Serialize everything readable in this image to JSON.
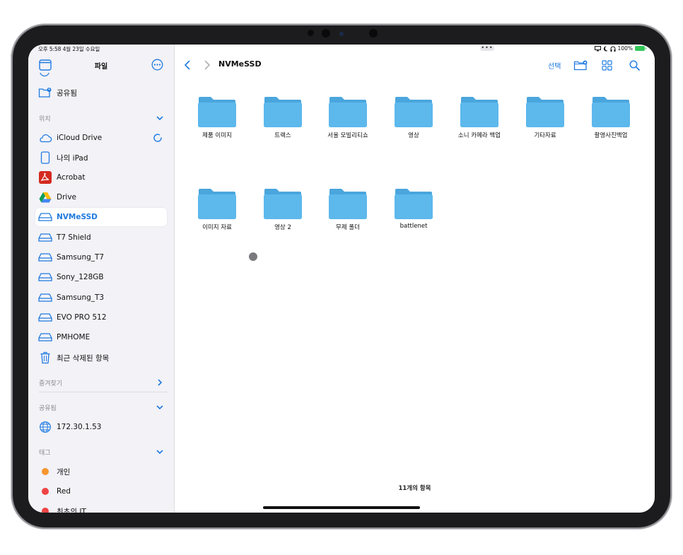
{
  "status": {
    "time_date": "오후 5:58  4월 23일 수요일",
    "battery": "100%"
  },
  "sidebar": {
    "title": "파일",
    "shared_top": "공유됨",
    "sections": {
      "locations": "위치",
      "favorites": "즐겨찾기",
      "shared": "공유됨",
      "tags": "태그"
    },
    "locations": [
      {
        "label": "iCloud Drive",
        "icon": "icloud-icon"
      },
      {
        "label": "나의 iPad",
        "icon": "ipad-icon"
      },
      {
        "label": "Acrobat",
        "icon": "acrobat-icon"
      },
      {
        "label": "Drive",
        "icon": "google-drive-icon"
      },
      {
        "label": "NVMeSSD",
        "icon": "drive-icon",
        "selected": true
      },
      {
        "label": "T7 Shield",
        "icon": "drive-icon"
      },
      {
        "label": "Samsung_T7",
        "icon": "drive-icon"
      },
      {
        "label": "Sony_128GB",
        "icon": "drive-icon"
      },
      {
        "label": "Samsung_T3",
        "icon": "drive-icon"
      },
      {
        "label": "EVO PRO 512",
        "icon": "drive-icon"
      },
      {
        "label": "PMHOME",
        "icon": "drive-icon"
      },
      {
        "label": "최근 삭제된 항목",
        "icon": "trash-icon"
      }
    ],
    "shared": [
      {
        "label": "172.30.1.53",
        "icon": "globe-icon"
      }
    ],
    "tags": [
      {
        "label": "개인",
        "color": "#f7962e"
      },
      {
        "label": "Red",
        "color": "#ee4444"
      },
      {
        "label": "최초의 IT",
        "color": "#ee4444"
      }
    ]
  },
  "toolbar": {
    "title": "NVMeSSD",
    "select_label": "선택"
  },
  "folders": [
    "제품 이미지",
    "트랙스",
    "서울 모빌리티쇼",
    "영상",
    "소니 카메라 백업",
    "기타자료",
    "촬영사진백업",
    "이미지 자료",
    "영상 2",
    "무제 폴더",
    "battlenet"
  ],
  "footer": {
    "count": "11개의 항목"
  },
  "colors": {
    "accent": "#1f7ae0",
    "folder": "#5db8ec",
    "folder_tab": "#4aa6dd"
  }
}
